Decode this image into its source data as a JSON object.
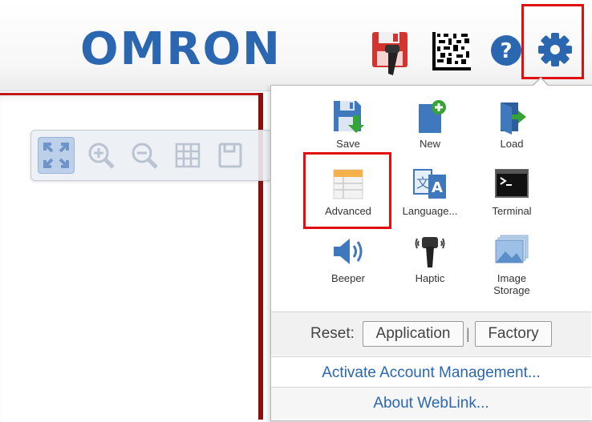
{
  "header": {
    "logo_text": "OMRON",
    "icons": [
      "save-to-reader-icon",
      "barcode-icon",
      "help-icon",
      "gear-icon"
    ]
  },
  "toolbar": {
    "buttons": [
      "fit-to-window-icon",
      "zoom-in-icon",
      "zoom-out-icon",
      "grid-icon",
      "save-image-icon"
    ]
  },
  "menu": {
    "items": [
      {
        "label": "Save",
        "icon": "save-icon"
      },
      {
        "label": "New",
        "icon": "new-icon"
      },
      {
        "label": "Load",
        "icon": "load-icon"
      },
      {
        "label": "Advanced",
        "icon": "advanced-icon"
      },
      {
        "label": "Language...",
        "icon": "language-icon"
      },
      {
        "label": "Terminal",
        "icon": "terminal-icon"
      },
      {
        "label": "Beeper",
        "icon": "beeper-icon"
      },
      {
        "label": "Haptic",
        "icon": "haptic-icon"
      },
      {
        "label": "Image Storage",
        "icon": "image-storage-icon"
      }
    ],
    "reset_label": "Reset:",
    "application_button": "Application",
    "factory_button": "Factory",
    "activate_link": "Activate Account Management...",
    "about_link": "About WebLink..."
  },
  "colors": {
    "brand": "#2b67b1",
    "highlight": "#e01010",
    "accent_red": "#c21818"
  }
}
